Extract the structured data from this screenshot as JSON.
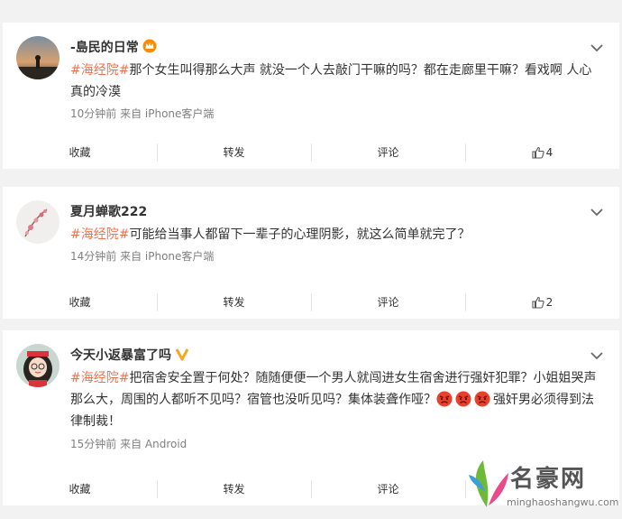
{
  "posts": [
    {
      "username": "-島民的日常",
      "hashtag": "#海经院#",
      "text": "那个女生叫得那么大声 就没一个人去敲门干嘛的吗？都在走廊里干嘛？看戏啊 人心真的冷漠",
      "meta": "10分钟前 来自 iPhone客户端",
      "actions": {
        "collect": "收藏",
        "repost": "转发",
        "comment": "评论",
        "likes": "4"
      }
    },
    {
      "username": "夏月蝉歌222",
      "hashtag": "#海经院#",
      "text": "可能给当事人都留下一辈子的心理阴影，就这么简单就完了？",
      "meta": "14分钟前 来自 iPhone客户端",
      "actions": {
        "collect": "收藏",
        "repost": "转发",
        "comment": "评论",
        "likes": "2"
      }
    },
    {
      "username": "今天小返暴富了吗",
      "hashtag": "#海经院#",
      "text": "把宿舍安全置于何处？随随便便一个男人就闯进女生宿舍进行强奸犯罪？小姐姐哭声那么大，周围的人都听不见吗？宿管也没听见吗？集体装聋作哑？",
      "text_end": "强奸男必须得到法律制裁！",
      "meta": "15分钟前 来自 Android",
      "actions": {
        "collect": "收藏",
        "repost": "转发",
        "comment": "评论"
      }
    }
  ],
  "watermark": {
    "title": "名豪网",
    "url": "minghaoshangwu.com"
  },
  "colors": {
    "hashtag": "#eb7350",
    "background": "#f2f2f2",
    "card": "#ffffff"
  },
  "icons": [
    "chevron-down-icon",
    "thumbs-up-icon",
    "crown-badge-icon",
    "verified-v-icon",
    "angry-emoji-icon"
  ]
}
